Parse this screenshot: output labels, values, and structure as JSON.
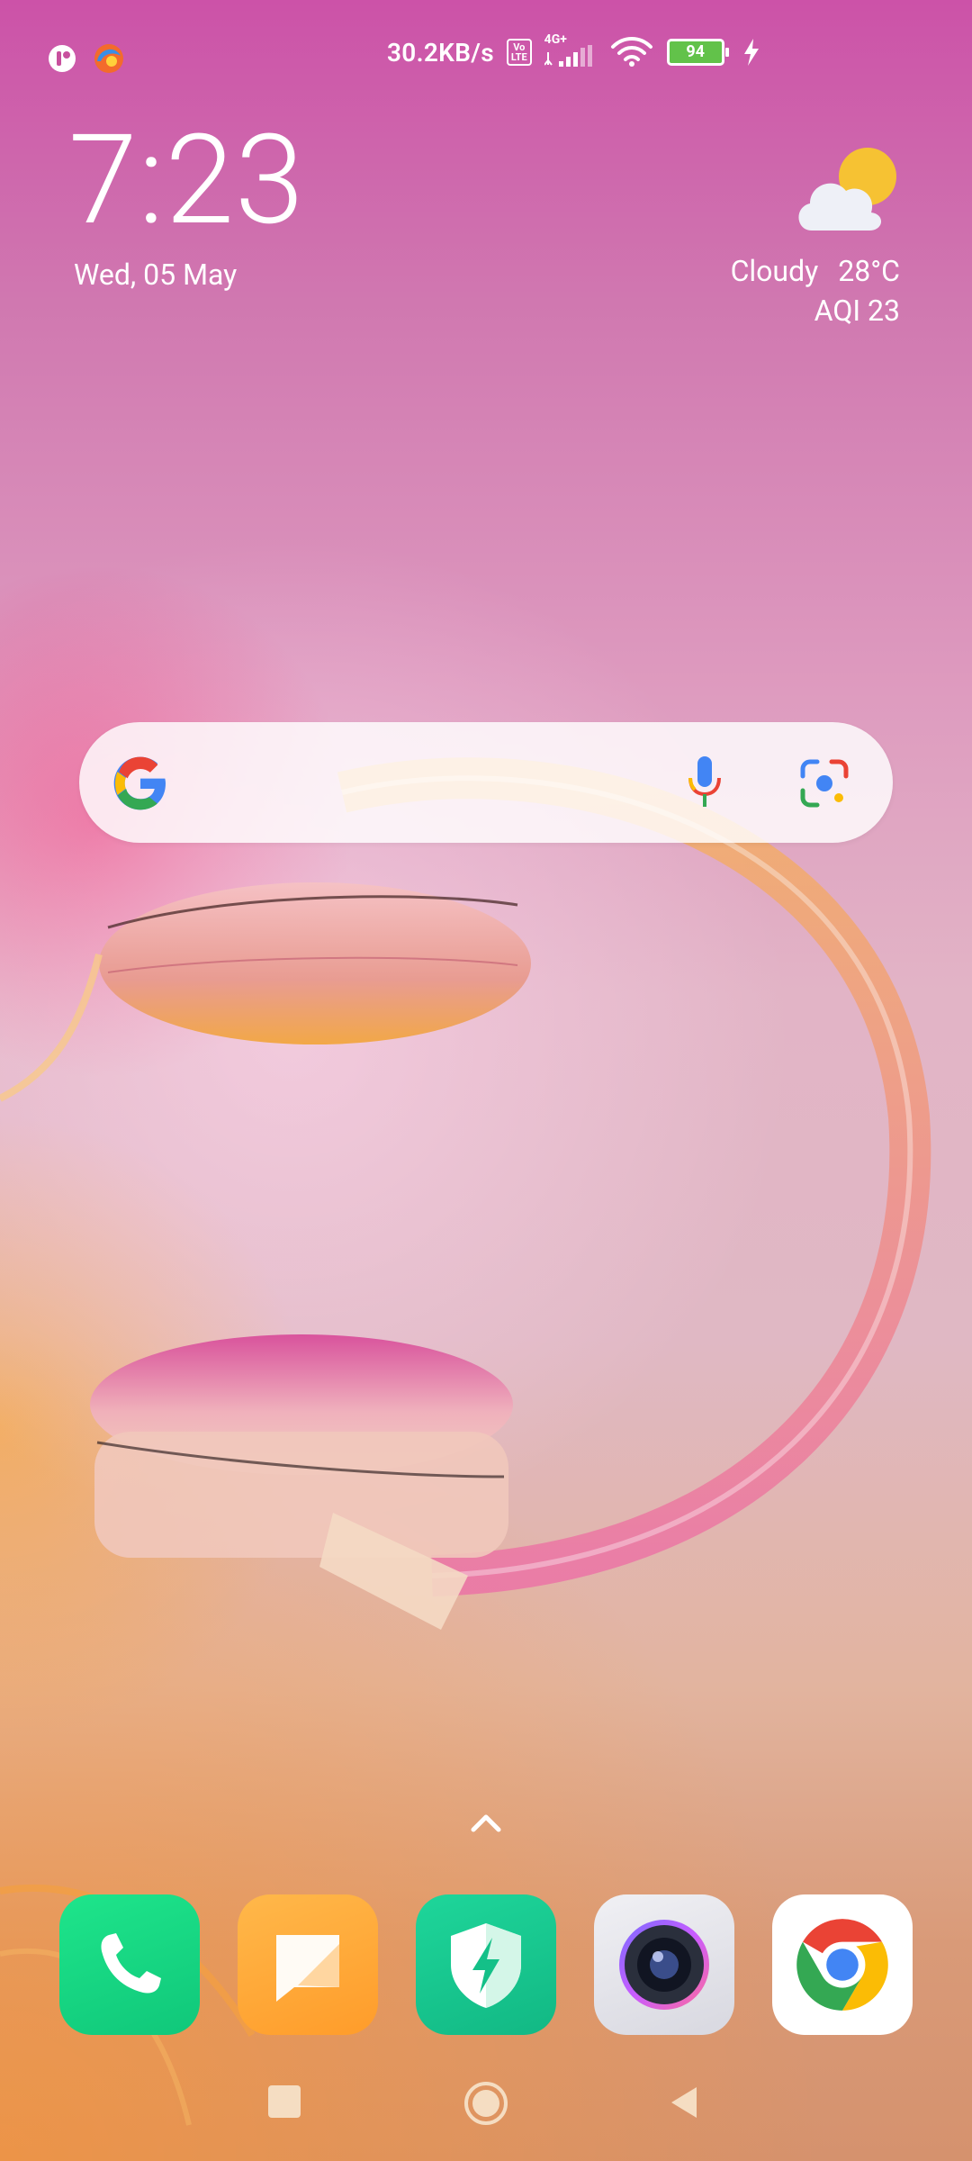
{
  "status_bar": {
    "network_speed": "30.2KB/s",
    "volte_label_top": "Vo",
    "volte_label_bottom": "LTE",
    "network_type": "4G+",
    "battery_level": "94"
  },
  "clock": {
    "time": "7:23",
    "date": "Wed, 05 May"
  },
  "weather": {
    "condition": "Cloudy",
    "temperature": "28°C",
    "aqi": "AQI 23"
  },
  "search_bar": {
    "logo": "google-icon",
    "mic": "mic-icon",
    "lens": "lens-icon"
  },
  "dock": [
    {
      "name": "Phone",
      "icon": "phone-icon"
    },
    {
      "name": "Messages",
      "icon": "message-icon"
    },
    {
      "name": "Security",
      "icon": "shield-icon"
    },
    {
      "name": "Camera",
      "icon": "camera-icon"
    },
    {
      "name": "Chrome",
      "icon": "chrome-icon"
    }
  ],
  "nav_bar": [
    "recents-button",
    "home-button",
    "back-button"
  ],
  "colors": {
    "wallpaper_top": "#cc52a8",
    "wallpaper_bottom": "#d5926e",
    "battery_fill": "#62c24a"
  }
}
